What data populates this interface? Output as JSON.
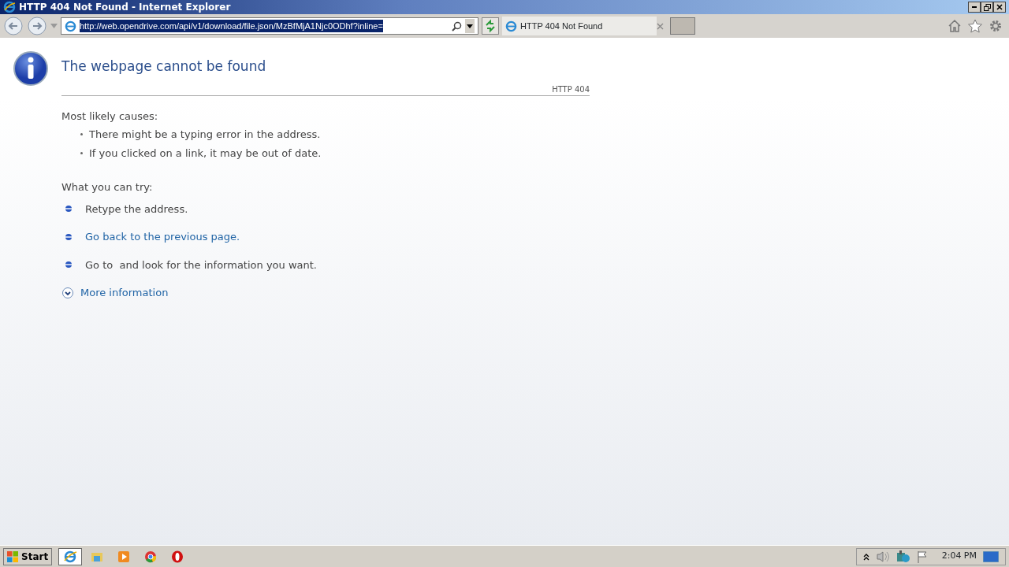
{
  "window": {
    "title": "HTTP 404 Not Found - Internet Explorer"
  },
  "address_bar": {
    "value": "http://web.opendrive.com/api/v1/download/file.json/MzBfMjA1Njc0ODhf?inline=",
    "selected": true
  },
  "tabs": [
    {
      "label": "HTTP 404 Not Found",
      "selected": true
    }
  ],
  "page": {
    "title": "The webpage cannot be found",
    "code": "HTTP 404",
    "causes_heading": "Most likely causes:",
    "causes": [
      "There might be a typing error in the address.",
      "If you clicked on a link, it may be out of date."
    ],
    "try_heading": "What you can try:",
    "try_items": [
      {
        "kind": "text",
        "text": "Retype the address."
      },
      {
        "kind": "link",
        "text": "Go back to the previous page."
      },
      {
        "kind": "text",
        "text": "Go to  and look for the information you want."
      }
    ],
    "more_info": "More information"
  },
  "taskbar": {
    "start": "Start",
    "apps": [
      {
        "kind": "ie",
        "active": true
      },
      {
        "kind": "folder",
        "active": false
      },
      {
        "kind": "media",
        "active": false
      },
      {
        "kind": "chrome",
        "active": false
      },
      {
        "kind": "opera",
        "active": false
      }
    ],
    "clock": "2:04 PM"
  }
}
